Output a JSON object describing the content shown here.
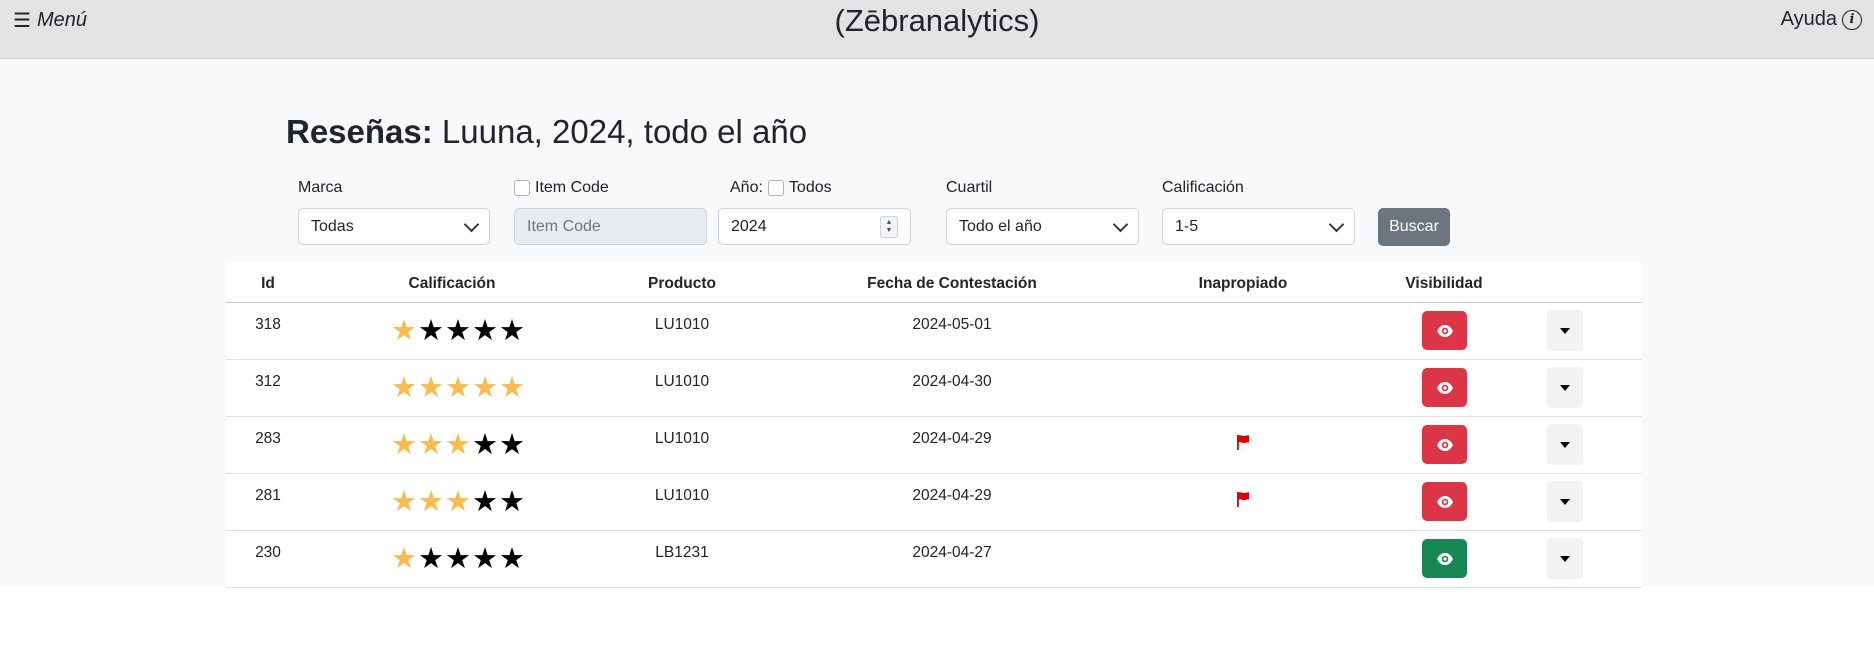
{
  "navbar": {
    "menu_icon": "menu-icon",
    "menu_label": "Menú",
    "brand": "(Zēbranalytics)",
    "help_label": "Ayuda",
    "help_icon": "info-icon",
    "help_icon_glyph": "i"
  },
  "page": {
    "title_bold": "Reseñas:",
    "title_rest": " Luuna, 2024, todo el año"
  },
  "filters": {
    "marca_label": "Marca",
    "marca_value": "Todas",
    "itemcode_label": "Item Code",
    "itemcode_placeholder": "Item Code",
    "anio_label": "Año:",
    "anio_todos_label": "Todos",
    "anio_value": "2024",
    "cuartil_label": "Cuartil",
    "cuartil_value": "Todo el año",
    "calificacion_label": "Calificación",
    "calificacion_value": "1-5",
    "search_button": "Buscar"
  },
  "table": {
    "headers": {
      "id": "Id",
      "calificacion": "Calificación",
      "producto": "Producto",
      "fecha": "Fecha de Contestación",
      "inapropiado": "Inapropiado",
      "visibilidad": "Visibilidad"
    },
    "rows": [
      {
        "id": "318",
        "rating": 1,
        "producto": "LU1010",
        "fecha": "2024-05-01",
        "flagged": false,
        "visible_state": "red"
      },
      {
        "id": "312",
        "rating": 5,
        "producto": "LU1010",
        "fecha": "2024-04-30",
        "flagged": false,
        "visible_state": "red"
      },
      {
        "id": "283",
        "rating": 3,
        "producto": "LU1010",
        "fecha": "2024-04-29",
        "flagged": true,
        "visible_state": "red"
      },
      {
        "id": "281",
        "rating": 3,
        "producto": "LU1010",
        "fecha": "2024-04-29",
        "flagged": true,
        "visible_state": "red"
      },
      {
        "id": "230",
        "rating": 1,
        "producto": "LB1231",
        "fecha": "2024-04-27",
        "flagged": false,
        "visible_state": "green"
      }
    ]
  },
  "colors": {
    "star_on": "#f7bb4f",
    "star_off": "#000000",
    "btn_red": "#dc3545",
    "btn_green": "#198754",
    "flag": "#e00000"
  }
}
